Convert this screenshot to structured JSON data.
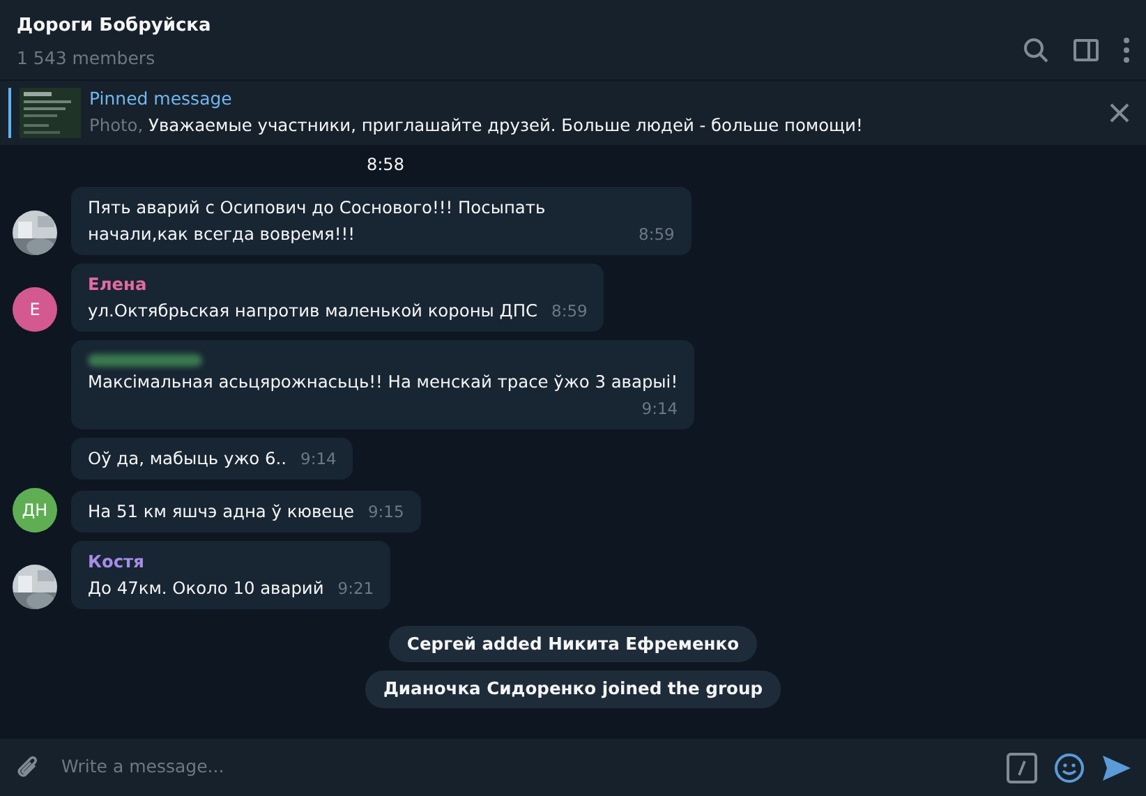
{
  "header": {
    "title": "Дороги Бобруйска",
    "subtitle": "1 543 members"
  },
  "pinned": {
    "title": "Pinned message",
    "prefix": "Photo,",
    "text": "Уважаемые участники, приглашайте друзей.  Больше людей - больше помощи!"
  },
  "date_pill": "8:58",
  "messages": [
    {
      "text": "Пять аварий с Осипович до Соснового!!! Посыпать начали,как всегда вовремя!!!",
      "time": "8:59"
    },
    {
      "avatar": {
        "kind": "letter",
        "initials": "Е",
        "color": "#d45990"
      },
      "sender": "Елена",
      "color": "#e36ba0",
      "text": "ул.Октябрьская  напротив маленькой короны ДПС",
      "time": "8:59"
    },
    {
      "sender_hidden": true,
      "text": "Максімальная асьцярожнасьць!! На менскай трасе ўжо 3 аварыі!",
      "time": "9:14"
    },
    {
      "text": "Оў да, мабыць ужо 6..",
      "time": "9:14"
    },
    {
      "avatar": {
        "kind": "letter",
        "initials": "ДН",
        "color": "#5fae54"
      },
      "text": "На 51 км яшчэ адна ў кювеце",
      "time": "9:15"
    },
    {
      "sender": "Костя",
      "color": "#a98ce8",
      "text": "До 47км. Около 10 аварий",
      "time": "9:21"
    }
  ],
  "service_messages": [
    "Сергей added Никита Ефременко",
    "Дианочка Сидоренко joined the group"
  ],
  "composer": {
    "placeholder": "Write a message..."
  }
}
